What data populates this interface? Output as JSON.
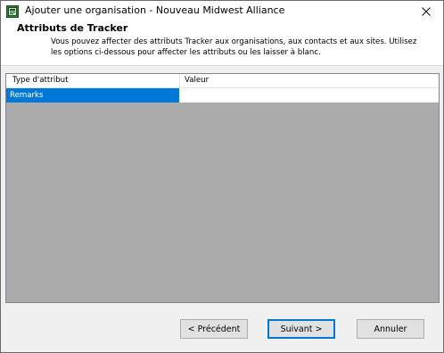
{
  "window": {
    "title": "Ajouter une organisation - Nouveau Midwest Alliance",
    "close_glyph": "✕"
  },
  "header": {
    "title": "Attributs de Tracker",
    "description": "Vous pouvez affecter des attributs Tracker aux organisations, aux contacts et aux sites. Utilisez les options ci-dessous pour affecter les attributs ou les laisser à blanc."
  },
  "grid": {
    "columns": [
      "Type d'attribut",
      "Valeur"
    ],
    "rows": [
      {
        "type": "Remarks",
        "value": ""
      }
    ]
  },
  "buttons": {
    "prev": "< Précédent",
    "next": "Suivant >",
    "cancel": "Annuler"
  },
  "colors": {
    "selection": "#0078d7",
    "grid_background": "#ababab",
    "dialog_background": "#f0f0f0"
  },
  "icons": {
    "app": "app-window-icon",
    "close": "close-icon"
  }
}
